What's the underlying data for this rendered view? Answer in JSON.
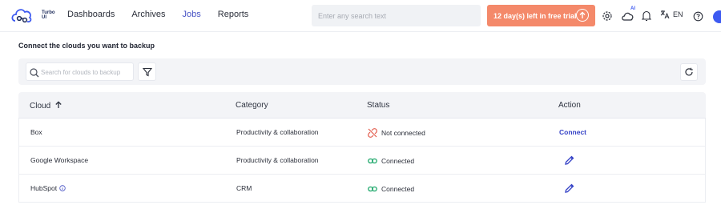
{
  "app": {
    "logo_text": "Turbo UI"
  },
  "nav": {
    "items": [
      {
        "label": "Dashboards"
      },
      {
        "label": "Archives"
      },
      {
        "label": "Jobs",
        "active": true
      },
      {
        "label": "Reports"
      }
    ]
  },
  "header": {
    "search_placeholder": "Enter any search text",
    "trial_label": "12 day(s) left in free trial",
    "ai_badge": "AI",
    "language": "EN",
    "icons": [
      "settings-icon",
      "cloud-ai-icon",
      "bell-icon",
      "translate-icon",
      "help-icon",
      "avatar"
    ]
  },
  "main": {
    "title": "Connect the clouds you want to backup",
    "search_placeholder": "Search for clouds to backup"
  },
  "table": {
    "headers": {
      "cloud": "Cloud",
      "category": "Category",
      "status": "Status",
      "action": "Action"
    },
    "rows": [
      {
        "cloud": "Box",
        "category": "Productivity & collaboration",
        "status": "Not connected",
        "action": "Connect"
      },
      {
        "cloud": "Google Workspace",
        "category": "Productivity & collaboration",
        "status": "Connected",
        "action": "edit"
      },
      {
        "cloud": "HubSpot",
        "category": "CRM",
        "status": "Connected",
        "action": "edit"
      }
    ]
  },
  "colors": {
    "accent": "#4752c4",
    "trial_bg": "#f4896a",
    "connected": "#1ea86b",
    "not_connected": "#e25b4b",
    "link": "#3441c6"
  }
}
